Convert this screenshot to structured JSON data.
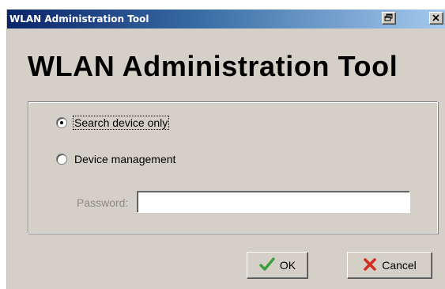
{
  "window": {
    "title": "WLAN Administration Tool",
    "titlebar_gradient": [
      "#0a246a",
      "#3a6ea5",
      "#a6caf0"
    ],
    "face_color": "#d4d0c8"
  },
  "titlebar_buttons": [
    {
      "icon": "restore-icon"
    },
    {
      "icon": "close-icon"
    }
  ],
  "heading": "WLAN Administration Tool",
  "options": {
    "search_only": {
      "label": "Search device only",
      "selected": true
    },
    "management": {
      "label": "Device management",
      "selected": false
    }
  },
  "password": {
    "label": "Password:",
    "value": "",
    "enabled": false
  },
  "buttons": {
    "ok": {
      "label": "OK",
      "icon": "checkmark-icon",
      "icon_color": "#3ca03c"
    },
    "cancel": {
      "label": "Cancel",
      "icon": "x-mark-icon",
      "icon_color": "#d03020"
    }
  }
}
